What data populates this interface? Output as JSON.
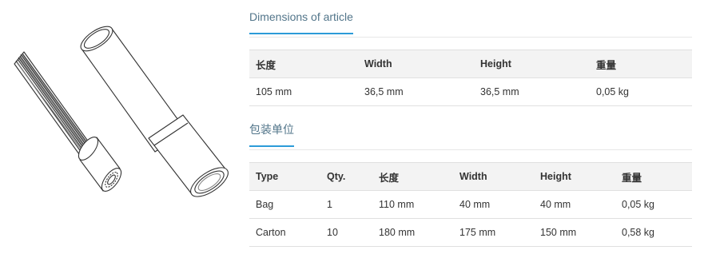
{
  "dimensions": {
    "tab_label": "Dimensions of article",
    "headers": [
      "长度",
      "Width",
      "Height",
      "重量"
    ],
    "rows": [
      [
        "105 mm",
        "36,5 mm",
        "36,5 mm",
        "0,05 kg"
      ]
    ]
  },
  "packaging": {
    "tab_label": "包装单位",
    "headers": [
      "Type",
      "Qty.",
      "长度",
      "Width",
      "Height",
      "重量"
    ],
    "rows": [
      [
        "Bag",
        "1",
        "110 mm",
        "40 mm",
        "40 mm",
        "0,05 kg"
      ],
      [
        "Carton",
        "10",
        "180 mm",
        "175 mm",
        "150 mm",
        "0,58 kg"
      ]
    ]
  },
  "colors": {
    "tab_underline": "#2c9bd8",
    "tab_text": "#52758a",
    "header_bg": "#f3f3f3"
  },
  "image": {
    "icon": "bit-holder-sleeve-drawing"
  }
}
